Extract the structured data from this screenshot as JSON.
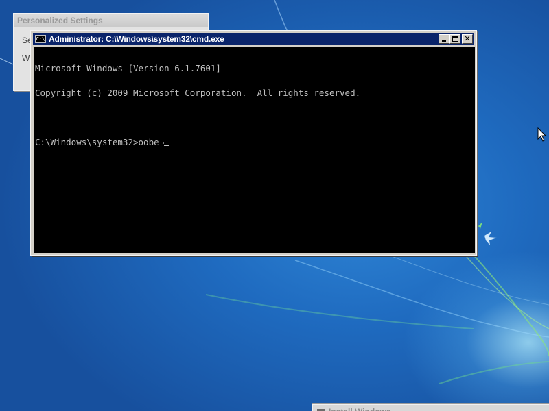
{
  "personalized_settings": {
    "title": "Personalized Settings",
    "line1_fragment": "Se",
    "line2_fragment": "W"
  },
  "cmd": {
    "title": "Administrator: C:\\Windows\\system32\\cmd.exe",
    "icon_label": "C:\\",
    "lines": [
      "Microsoft Windows [Version 6.1.7601]",
      "Copyright (c) 2009 Microsoft Corporation.  All rights reserved.",
      "",
      "C:\\Windows\\system32>oobe¬"
    ],
    "buttons": {
      "minimize": "minimize",
      "maximize": "maximize",
      "close": "✕"
    }
  },
  "install_windows": {
    "title": "Install Windows"
  },
  "colors": {
    "title_bar": "#0a246a",
    "console_bg": "#000000",
    "console_text": "#c0c0c0",
    "desktop": "#1f6bc0"
  }
}
